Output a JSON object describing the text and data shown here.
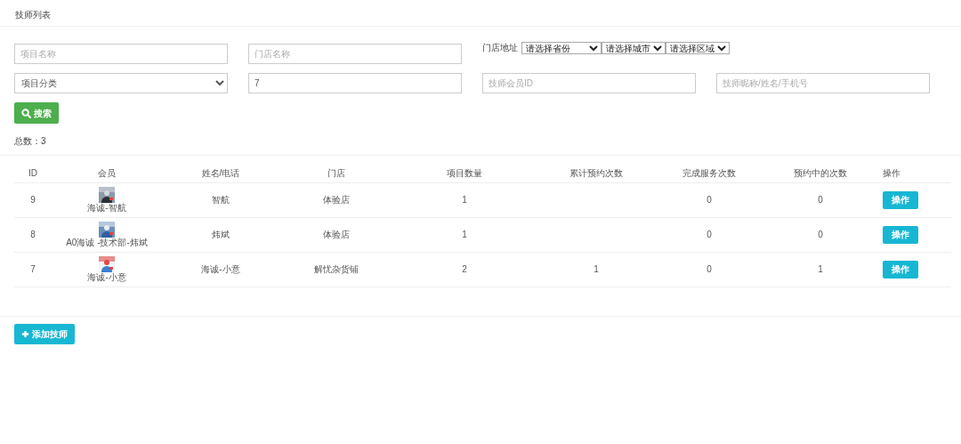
{
  "title": "技师列表",
  "filters": {
    "project_name": {
      "placeholder": "项目名称"
    },
    "store_name": {
      "placeholder": "门店名称"
    },
    "address": {
      "label": "门店地址",
      "selects": [
        "请选择省份",
        "请选择城市",
        "请选择区域"
      ]
    },
    "category": {
      "value": "项目分类"
    },
    "keyword": {
      "value": "7"
    },
    "member_id": {
      "placeholder": "技师会员ID"
    },
    "nickname": {
      "placeholder": "技师昵称/姓名/手机号"
    }
  },
  "search_button": "搜索",
  "total": "总数：3",
  "table": {
    "columns": [
      "ID",
      "会员",
      "姓名/电话",
      "门店",
      "项目数量",
      "累计预约次数",
      "完成服务次数",
      "预约中的次数",
      "操作"
    ],
    "rows": [
      {
        "id": "9",
        "member": "海诚-智航",
        "name": "智航",
        "store": "体验店",
        "projects": "1",
        "done": "0",
        "pending": "0",
        "action": "操作"
      },
      {
        "id": "8",
        "member": "A0海诚 -技术部-炜斌",
        "name": "炜斌",
        "store": "体验店",
        "projects": "1",
        "done": "0",
        "pending": "0",
        "action": "操作"
      },
      {
        "id": "7",
        "member": "海诚-小意",
        "name": "海诚-小意",
        "store": "解忧杂货铺",
        "projects": "2",
        "bookings": "1",
        "done": "0",
        "pending": "1",
        "action": "操作"
      }
    ]
  },
  "add_button": "添加技师"
}
